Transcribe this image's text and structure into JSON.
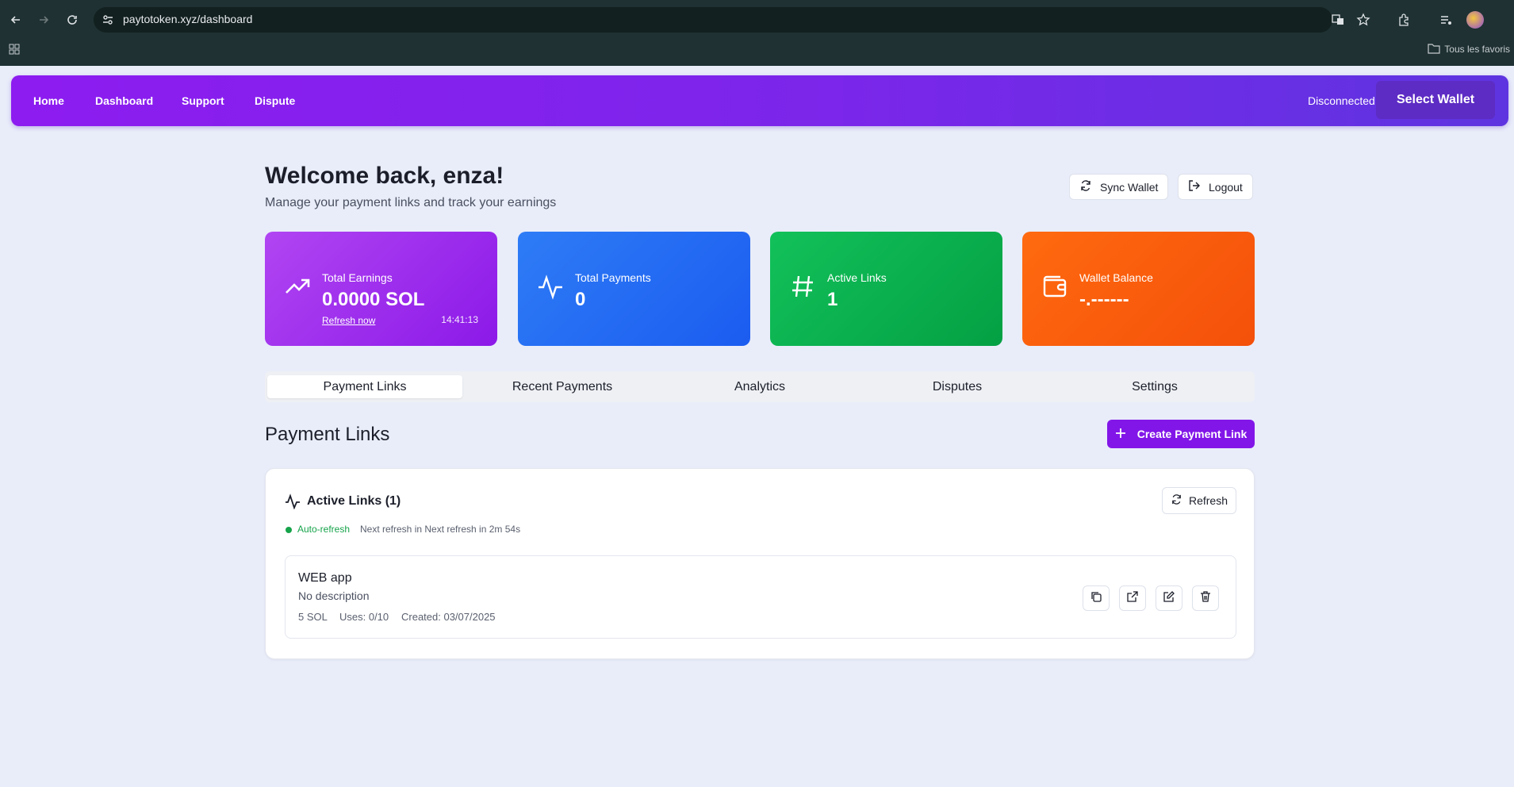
{
  "browser": {
    "url": "paytotoken.xyz/dashboard",
    "bookmarks_label": "Tous les favoris"
  },
  "nav": {
    "links": [
      "Home",
      "Dashboard",
      "Support",
      "Dispute"
    ],
    "status": "Disconnected",
    "select_wallet": "Select Wallet"
  },
  "header": {
    "title": "Welcome back, enza!",
    "subtitle": "Manage your payment links and track your earnings",
    "sync_label": "Sync Wallet",
    "logout_label": "Logout"
  },
  "stats": [
    {
      "label": "Total Earnings",
      "value": "0.0000 SOL",
      "link": "Refresh now",
      "time": "14:41:13",
      "color_from": "#b145f2",
      "color_to": "#8c19e8"
    },
    {
      "label": "Total Payments",
      "value": "0",
      "color_from": "#2e7cf6",
      "color_to": "#1b5cf0"
    },
    {
      "label": "Active Links",
      "value": "1",
      "color_from": "#12c15a",
      "color_to": "#04a043"
    },
    {
      "label": "Wallet Balance",
      "value": "-.------",
      "color_from": "#ff6a0f",
      "color_to": "#f4500a"
    }
  ],
  "tabs": [
    "Payment Links",
    "Recent Payments",
    "Analytics",
    "Disputes",
    "Settings"
  ],
  "section": {
    "title": "Payment Links",
    "create_label": "Create Payment Link"
  },
  "panel": {
    "title": "Active Links (1)",
    "refresh_label": "Refresh",
    "auto_refresh": "Auto-refresh",
    "next_refresh": "Next refresh in Next refresh in 2m 54s"
  },
  "links": [
    {
      "name": "WEB app",
      "description": "No description",
      "price": "5 SOL",
      "uses": "Uses: 0/10",
      "created": "Created: 03/07/2025"
    }
  ]
}
